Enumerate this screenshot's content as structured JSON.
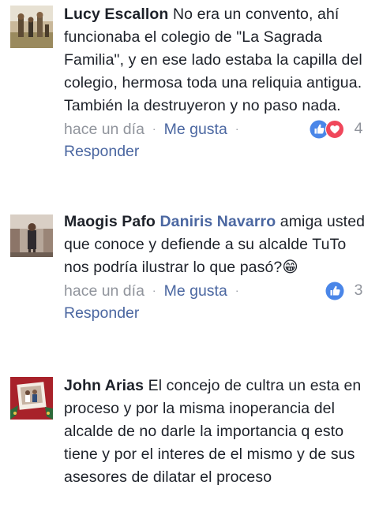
{
  "comments": [
    {
      "author": "Lucy Escallon",
      "mention": "",
      "text": "No era un convento, ahí funcionaba el colegio de \"La Sagrada Familia\", y en ese lado estaba la capilla del colegio, hermosa toda una reliquia antigua.  También la destruyeron y no paso nada.",
      "time": "hace un día",
      "like_label": "Me gusta",
      "reply_label": "Responder",
      "reaction_count": "4",
      "reactions": [
        "like-icon",
        "love-icon"
      ]
    },
    {
      "author": "Maogis Pafo",
      "mention": "Daniris Navarro",
      "text": "amiga usted que conoce y defiende a su alcalde TuTo nos podría ilustrar lo que pasó?😁",
      "time": "hace un día",
      "like_label": "Me gusta",
      "reply_label": "Responder",
      "reaction_count": "3",
      "reactions": [
        "like-icon"
      ]
    },
    {
      "author": "John Arias",
      "mention": "",
      "text": "El concejo de cultra un esta en proceso y por la misma inoperancia del alcalde de no darle la importancia q esto tiene y por el interes de el mismo y de sus asesores de dilatar el proceso"
    }
  ],
  "meta_separator": "·",
  "colors": {
    "link_blue": "#4b67a1",
    "meta_gray": "#90949c",
    "text_dark": "#1d2129",
    "like_blue": "#4a86e8",
    "love_red": "#f0475b"
  }
}
